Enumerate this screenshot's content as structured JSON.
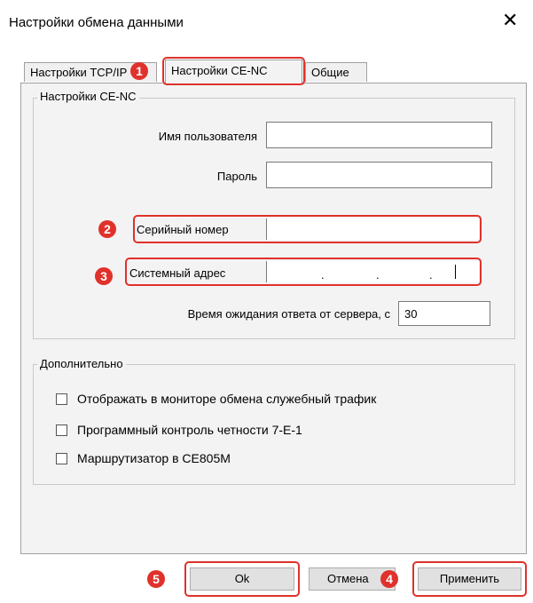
{
  "window": {
    "title": "Настройки обмена данными",
    "close_icon": "close-icon"
  },
  "tabs": [
    {
      "label": "Настройки TCP/IP",
      "active": false
    },
    {
      "label": "Настройки CE-NC",
      "active": true
    },
    {
      "label": "Общие",
      "active": false
    }
  ],
  "cenc_group": {
    "title": "Настройки CE-NC",
    "username_label": "Имя пользователя",
    "username_value": "",
    "password_label": "Пароль",
    "password_value": "",
    "serial_label": "Серийный номер",
    "serial_value": "",
    "address_label": "Системный адрес",
    "address_dots": ".",
    "timeout_label": "Время ожидания ответа от сервера, с",
    "timeout_value": "30"
  },
  "extra_group": {
    "title": "Дополнительно",
    "checkboxes": [
      {
        "label": "Отображать в мониторе обмена служебный трафик",
        "checked": false
      },
      {
        "label": "Программный контроль четности 7-E-1",
        "checked": false
      },
      {
        "label": "Маршрутизатор в CE805M",
        "checked": false
      }
    ]
  },
  "buttons": {
    "ok": "Ok",
    "cancel": "Отмена",
    "apply": "Применить"
  },
  "callouts": [
    "1",
    "2",
    "3",
    "4",
    "5"
  ],
  "colors": {
    "callout_red": "#e0312b",
    "panel_bg": "#f3f3f3"
  }
}
